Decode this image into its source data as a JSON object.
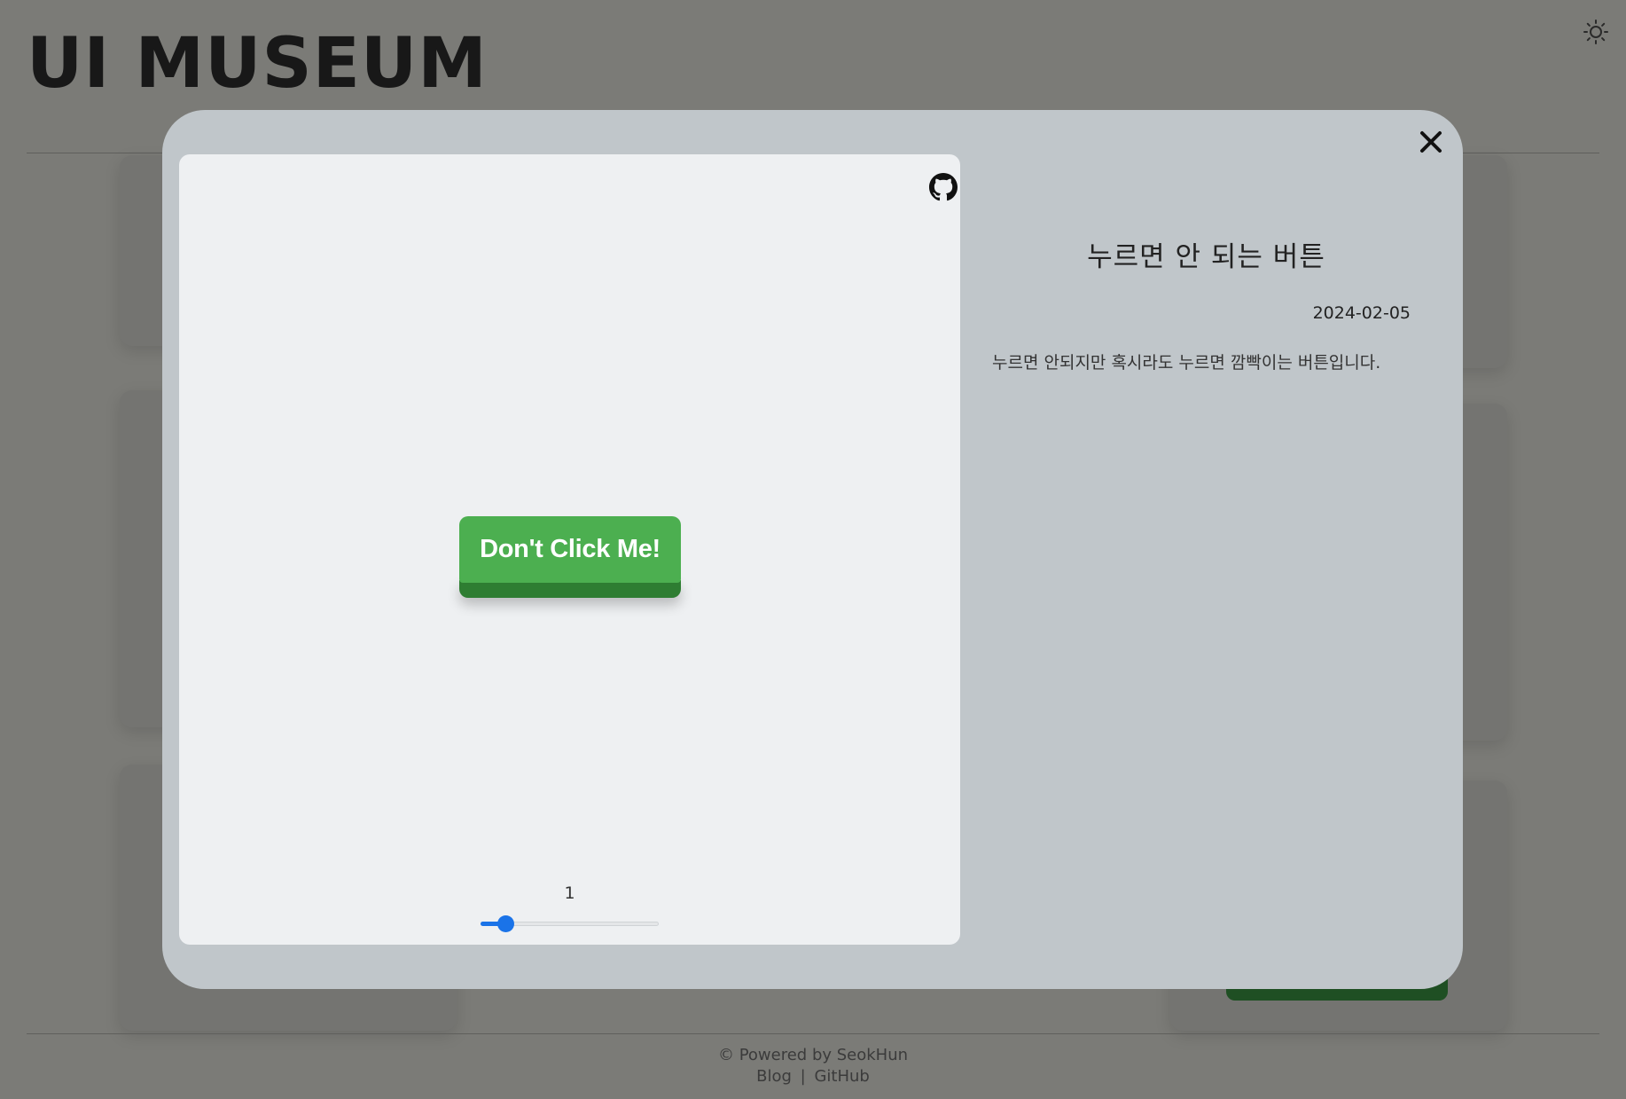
{
  "site": {
    "title": "UI MUSEUM",
    "theme_icon": "sun-icon"
  },
  "footer": {
    "powered": "© Powered by SeokHun",
    "blog": "Blog",
    "separator": "|",
    "github": "GitHub"
  },
  "modal": {
    "close_icon": "close-icon",
    "github_icon": "github-icon",
    "preview_button_label": "Don't Click Me!",
    "slider": {
      "value": "1",
      "min": 1,
      "max": 10
    },
    "title": "누르면 안 되는 버튼",
    "date": "2024-02-05",
    "description": "누르면 안되지만 혹시라도 누르면 깜빡이는 버튼입니다.",
    "colors": {
      "button_face": "#4caf50",
      "button_base": "#2e7d32",
      "slider_accent": "#1a73e8"
    }
  }
}
